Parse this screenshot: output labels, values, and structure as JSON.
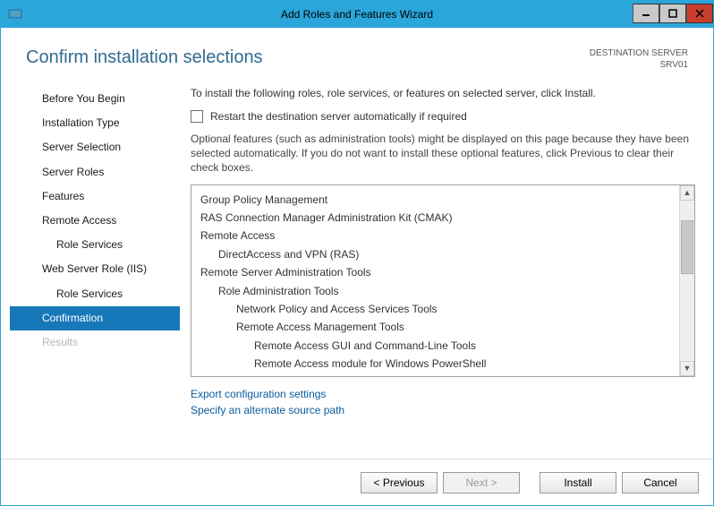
{
  "titlebar": {
    "title": "Add Roles and Features Wizard"
  },
  "header": {
    "page_title": "Confirm installation selections",
    "dest_label": "DESTINATION SERVER",
    "dest_value": "SRV01"
  },
  "nav": {
    "items": [
      {
        "label": "Before You Begin",
        "sub": false,
        "selected": false,
        "disabled": false
      },
      {
        "label": "Installation Type",
        "sub": false,
        "selected": false,
        "disabled": false
      },
      {
        "label": "Server Selection",
        "sub": false,
        "selected": false,
        "disabled": false
      },
      {
        "label": "Server Roles",
        "sub": false,
        "selected": false,
        "disabled": false
      },
      {
        "label": "Features",
        "sub": false,
        "selected": false,
        "disabled": false
      },
      {
        "label": "Remote Access",
        "sub": false,
        "selected": false,
        "disabled": false
      },
      {
        "label": "Role Services",
        "sub": true,
        "selected": false,
        "disabled": false
      },
      {
        "label": "Web Server Role (IIS)",
        "sub": false,
        "selected": false,
        "disabled": false
      },
      {
        "label": "Role Services",
        "sub": true,
        "selected": false,
        "disabled": false
      },
      {
        "label": "Confirmation",
        "sub": false,
        "selected": true,
        "disabled": false
      },
      {
        "label": "Results",
        "sub": false,
        "selected": false,
        "disabled": true
      }
    ]
  },
  "main": {
    "intro": "To install the following roles, role services, or features on selected server, click Install.",
    "restart_label": "Restart the destination server automatically if required",
    "optional": "Optional features (such as administration tools) might be displayed on this page because they have been selected automatically. If you do not want to install these optional features, click Previous to clear their check boxes.",
    "list": [
      {
        "text": "Group Policy Management",
        "indent": 0
      },
      {
        "text": "RAS Connection Manager Administration Kit (CMAK)",
        "indent": 0
      },
      {
        "text": "Remote Access",
        "indent": 0
      },
      {
        "text": "DirectAccess and VPN (RAS)",
        "indent": 1
      },
      {
        "text": "Remote Server Administration Tools",
        "indent": 0
      },
      {
        "text": "Role Administration Tools",
        "indent": 1
      },
      {
        "text": "Network Policy and Access Services Tools",
        "indent": 2
      },
      {
        "text": "Remote Access Management Tools",
        "indent": 2
      },
      {
        "text": "Remote Access GUI and Command-Line Tools",
        "indent": 3
      },
      {
        "text": "Remote Access module for Windows PowerShell",
        "indent": 3
      }
    ],
    "link_export": "Export configuration settings",
    "link_path": "Specify an alternate source path"
  },
  "footer": {
    "previous": "< Previous",
    "next": "Next >",
    "install": "Install",
    "cancel": "Cancel"
  }
}
